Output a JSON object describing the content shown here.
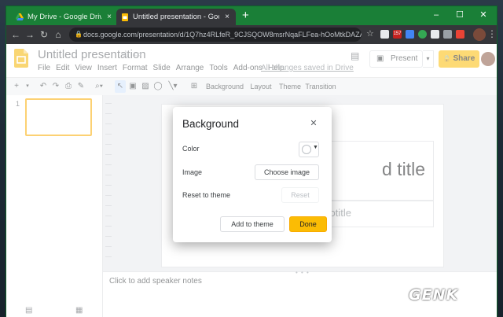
{
  "browser": {
    "tabs": [
      {
        "title": "My Drive - Google Drive",
        "close": "×"
      },
      {
        "title": "Untitled presentation - Google Sli",
        "close": "×"
      }
    ],
    "new_tab": "+",
    "window_controls": {
      "minimize": "–",
      "maximize": "☐",
      "close": "✕"
    },
    "url": "docs.google.com/presentation/d/1Q7hz4RLfeR_9CJSQOW8msrNqaFLFea-hOoMtkDAZAEs/edit#sli...",
    "ext_badge": "157",
    "nav": {
      "back": "←",
      "forward": "→",
      "reload": "↻",
      "home": "⌂"
    }
  },
  "app": {
    "doc_title": "Untitled presentation",
    "menu": [
      "File",
      "Edit",
      "View",
      "Insert",
      "Format",
      "Slide",
      "Arrange",
      "Tools",
      "Add-ons",
      "Help"
    ],
    "save_status": "All changes saved in Drive",
    "present_label": "Present",
    "share_label": "Share",
    "share_icon": "🔒"
  },
  "toolbar": {
    "background": "Background",
    "layout": "Layout",
    "theme": "Theme",
    "transition": "Transition"
  },
  "filmstrip": {
    "slide_number": "1"
  },
  "slide": {
    "title_visible": "d title",
    "subtitle_visible": "otitle"
  },
  "notes": {
    "placeholder": "Click to add speaker notes"
  },
  "dialog": {
    "title": "Background",
    "close": "✕",
    "color_label": "Color",
    "image_label": "Image",
    "reset_label": "Reset to theme",
    "choose_image": "Choose image",
    "reset_button": "Reset",
    "add_to_theme": "Add to theme",
    "done": "Done"
  },
  "watermark": "GENK",
  "colors": {
    "titlebar": "#1a7f37",
    "accent": "#fbbc04",
    "selection": "#f9ab00"
  }
}
